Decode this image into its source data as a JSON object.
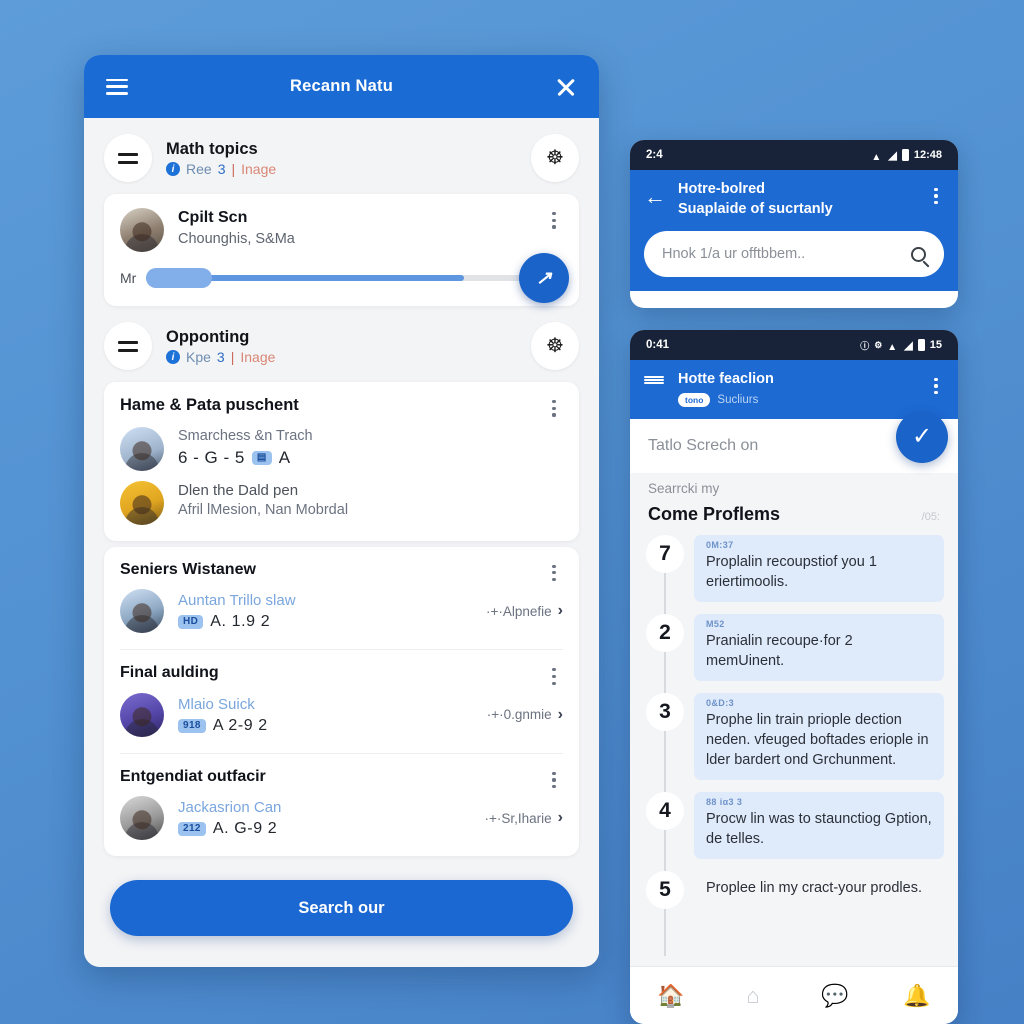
{
  "theme": {
    "primary_blue": "#1a6cd4",
    "accent_blue": "#1b68d2",
    "page_bg_top": "#5d9cd9",
    "page_bg_bottom": "#4680c6",
    "card_bg": "#ffffff",
    "panel_bg": "#f3f4f6",
    "problem_box_bg": "#dfeafb"
  },
  "dialog": {
    "title": "Recann Natu",
    "menu_icon": "hamburger-icon",
    "close_icon": "close-icon",
    "sections": [
      {
        "title": "Math topics",
        "sub_prefix": "Ree",
        "sub_num": "3",
        "sub_pipe": "|",
        "sub_suffix": "Inage",
        "left_icon": "equals-icon",
        "right_icon": "globe-icon"
      },
      {
        "title": "Opponting",
        "sub_prefix": "Kpe",
        "sub_num": "3",
        "sub_pipe": "|",
        "sub_suffix": "Inage",
        "left_icon": "equals-icon",
        "right_icon": "globe-icon"
      }
    ],
    "profile_card": {
      "name": "Cpilt Scn",
      "meta": "Chounghis, S&Ma",
      "slider_label": "Mr",
      "slider_fill_percent": 77,
      "fab_glyph": "↗",
      "kebab_icon": "more-vertical-icon"
    },
    "group_card": {
      "title": "Hame & Pata puschent",
      "rows": [
        {
          "line1": "Smarchess &n Trach",
          "code_a": "6 - G - 5",
          "badge": "▤",
          "code_b": "A"
        },
        {
          "line1": "Dlen the Dald pen",
          "line2": "Afril lMesion, Nan Mobrdal"
        }
      ]
    },
    "list_items": [
      {
        "title": "Seniers Wistanew",
        "name": "Auntan Trillo slaw",
        "badge": "HD",
        "code": "A. 1.9 2",
        "right_text": "·+·Alpnefie",
        "chevron": "chevron-right-icon"
      },
      {
        "title": "Final aulding",
        "name": "Mlaio Suick",
        "badge": "918",
        "code": "A  2-9 2",
        "right_text": "·+·0.gnmie",
        "chevron": "chevron-right-icon"
      },
      {
        "title": "Entgendiat outfacir",
        "name": "Jackasrion Can",
        "badge": "212",
        "code": "A. G-9 2",
        "right_text": "·+·Sr,Iharie",
        "chevron": "chevron-right-icon"
      }
    ],
    "footer_button": "Search our"
  },
  "phone_a": {
    "status": {
      "time_left": "2:4",
      "time_right": "12:48",
      "icons": [
        "wifi-icon",
        "signal-icon",
        "battery-icon"
      ]
    },
    "appbar": {
      "back_icon": "back-arrow-icon",
      "title_line1": "Hotre-bolred",
      "title_line2": "Suaplaide of sucrtanly",
      "kebab_icon": "more-vertical-icon"
    },
    "search": {
      "placeholder": "Hnok 1/a ur offtbbem..",
      "icon": "search-icon"
    }
  },
  "phone_b": {
    "status": {
      "time_left": "0:41",
      "time_right": "15",
      "icons": [
        "clock-icon",
        "settings-icon",
        "wifi-icon",
        "signal-icon",
        "battery-icon"
      ]
    },
    "appbar": {
      "menu_icon": "hamburger-icon",
      "title": "Hotte feaclion",
      "chip": "tono",
      "subtitle": "Sucliurs",
      "kebab_icon": "more-vertical-icon"
    },
    "input": {
      "placeholder": "Tatlo Screch on",
      "confirm_icon": "check-icon"
    },
    "subline": "Searrcki my",
    "list": {
      "title": "Come Proflems",
      "count": "/05:",
      "items": [
        {
          "num": "7",
          "tag": "0M:37",
          "text": "Proplalin recoupstiof you 1 eriertimoolis."
        },
        {
          "num": "2",
          "tag": "M52",
          "text": "Pranialin recoupe·for 2 memUinent."
        },
        {
          "num": "3",
          "tag": "0&D:3",
          "text": "Prophe lin train priople dection neden. vfeuged boftades eriople in lder bardert ond Grchunment."
        },
        {
          "num": "4",
          "tag": "88 iα3 3",
          "text": "Procw lin was to staunctiog Gption, de telles."
        },
        {
          "num": "5",
          "tag": "",
          "text": "Proplee lin my cract-your prodles."
        }
      ]
    },
    "bottom_nav": [
      {
        "icon": "home-filled-icon",
        "active": true
      },
      {
        "icon": "home-outline-icon",
        "active": false
      },
      {
        "icon": "chat-icon",
        "active": true
      },
      {
        "icon": "bell-icon",
        "active": true
      }
    ]
  }
}
